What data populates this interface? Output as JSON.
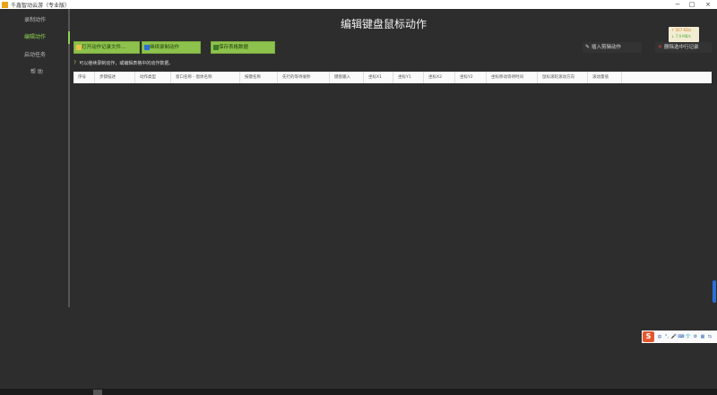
{
  "window": {
    "title": "千鑫智动云游（专业版）",
    "controls": {
      "minimize": "−",
      "maximize": "□",
      "close": "×"
    }
  },
  "sidebar": {
    "items": [
      {
        "label": "录制动作"
      },
      {
        "label": "编辑动作"
      },
      {
        "label": "启动任务"
      },
      {
        "label": "帮 助"
      }
    ]
  },
  "page": {
    "title": "编辑键盘鼠标动作"
  },
  "netspeed": {
    "up": "↑ 567 KB/s",
    "down": "↓ 7.9 MB/s"
  },
  "toolbar": {
    "open_label": "打开动作记录文件...",
    "continue_record_label": "继续录制动作",
    "save_table_label": "保存表格数据",
    "insert_label": "插入剪辑动作",
    "delete_label": "删除选中行记录"
  },
  "hint": "可以继续录制动作，或编辑表格中的动作数据。",
  "table": {
    "columns": [
      "序号",
      "步骤描述",
      "动作类型",
      "窗口名称 - 窗体名称",
      "按键名称",
      "先行的等待毫秒",
      "键盘输入",
      "坐标X1",
      "坐标Y1",
      "坐标X2",
      "坐标Y2",
      "坐标移动等待时间",
      "鼠标滚轮滚动方向",
      "滚动量值"
    ],
    "rows": []
  },
  "colors": {
    "accent": "#8dc24c",
    "background": "#2d2d2d",
    "scrollbar": "#2b6fd6",
    "ime": "#e4572e"
  },
  "ime": {
    "logo": "S",
    "lang": "中"
  }
}
